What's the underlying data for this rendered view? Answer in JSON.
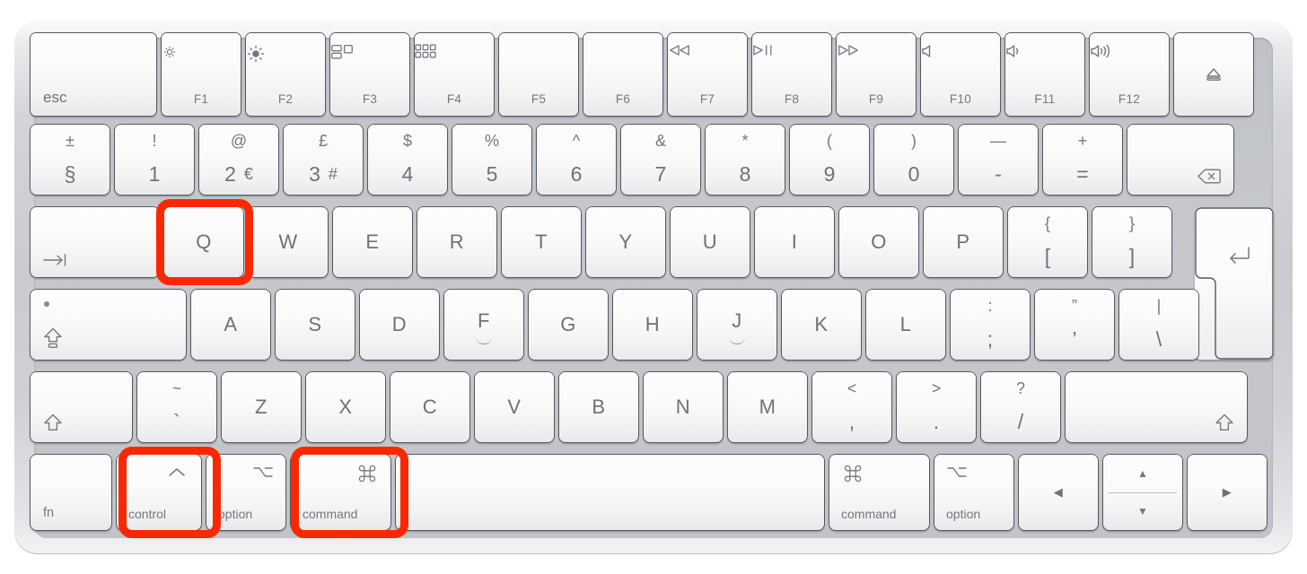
{
  "device": {
    "name": "Apple Magic Keyboard",
    "layout": "UK / ISO",
    "body_color": "#c9cbd0",
    "key_color": "#fafafa",
    "legend_color": "#6e7178"
  },
  "annotations": {
    "highlight_color": "#fa2800",
    "highlighted_keys": [
      "Q",
      "control",
      "command"
    ],
    "shortcut": "control + command + Q"
  },
  "rows": {
    "function_row": [
      {
        "id": "esc",
        "label": "esc",
        "icon": "",
        "icon_name": ""
      },
      {
        "id": "f1",
        "label": "F1",
        "icon": "brightness-down",
        "icon_name": "brightness-down-icon"
      },
      {
        "id": "f2",
        "label": "F2",
        "icon": "brightness-up",
        "icon_name": "brightness-up-icon"
      },
      {
        "id": "f3",
        "label": "F3",
        "icon": "mission-control",
        "icon_name": "mission-control-icon"
      },
      {
        "id": "f4",
        "label": "F4",
        "icon": "launchpad",
        "icon_name": "launchpad-icon"
      },
      {
        "id": "f5",
        "label": "F5",
        "icon": "",
        "icon_name": ""
      },
      {
        "id": "f6",
        "label": "F6",
        "icon": "",
        "icon_name": ""
      },
      {
        "id": "f7",
        "label": "F7",
        "icon": "rewind",
        "icon_name": "rewind-icon"
      },
      {
        "id": "f8",
        "label": "F8",
        "icon": "play-pause",
        "icon_name": "play-pause-icon"
      },
      {
        "id": "f9",
        "label": "F9",
        "icon": "fast-forward",
        "icon_name": "fast-forward-icon"
      },
      {
        "id": "f10",
        "label": "F10",
        "icon": "mute",
        "icon_name": "mute-icon"
      },
      {
        "id": "f11",
        "label": "F11",
        "icon": "volume-down",
        "icon_name": "volume-down-icon"
      },
      {
        "id": "f12",
        "label": "F12",
        "icon": "volume-up",
        "icon_name": "volume-up-icon"
      },
      {
        "id": "eject",
        "label": "",
        "icon": "eject",
        "icon_name": "eject-icon"
      }
    ],
    "number_row": [
      {
        "id": "section",
        "top": "±",
        "bottom": "§",
        "alt": ""
      },
      {
        "id": "digit1",
        "top": "!",
        "bottom": "1",
        "alt": ""
      },
      {
        "id": "digit2",
        "top": "@",
        "bottom": "2",
        "alt": "€"
      },
      {
        "id": "digit3",
        "top": "£",
        "bottom": "3",
        "alt": "#"
      },
      {
        "id": "digit4",
        "top": "$",
        "bottom": "4",
        "alt": ""
      },
      {
        "id": "digit5",
        "top": "%",
        "bottom": "5",
        "alt": ""
      },
      {
        "id": "digit6",
        "top": "^",
        "bottom": "6",
        "alt": ""
      },
      {
        "id": "digit7",
        "top": "&",
        "bottom": "7",
        "alt": ""
      },
      {
        "id": "digit8",
        "top": "*",
        "bottom": "8",
        "alt": ""
      },
      {
        "id": "digit9",
        "top": "(",
        "bottom": "9",
        "alt": ""
      },
      {
        "id": "digit0",
        "top": ")",
        "bottom": "0",
        "alt": ""
      },
      {
        "id": "minus",
        "top": "—",
        "bottom": "-",
        "alt": ""
      },
      {
        "id": "equal",
        "top": "+",
        "bottom": "=",
        "alt": ""
      },
      {
        "id": "delete",
        "top": "",
        "bottom": "",
        "alt": "",
        "icon_name": "delete-icon"
      }
    ],
    "top_letter_row": [
      {
        "id": "tab",
        "label": "",
        "icon_name": "tab-icon"
      },
      {
        "id": "q",
        "label": "Q"
      },
      {
        "id": "w",
        "label": "W"
      },
      {
        "id": "e",
        "label": "E"
      },
      {
        "id": "r",
        "label": "R"
      },
      {
        "id": "t",
        "label": "T"
      },
      {
        "id": "y",
        "label": "Y"
      },
      {
        "id": "u",
        "label": "U"
      },
      {
        "id": "i",
        "label": "I"
      },
      {
        "id": "o",
        "label": "O"
      },
      {
        "id": "p",
        "label": "P"
      },
      {
        "id": "bracketleft",
        "top": "{",
        "bottom": "["
      },
      {
        "id": "bracketright",
        "top": "}",
        "bottom": "]"
      }
    ],
    "home_row": [
      {
        "id": "capslock",
        "label": "",
        "icon_name": "caps-lock-icon"
      },
      {
        "id": "a",
        "label": "A"
      },
      {
        "id": "s",
        "label": "S"
      },
      {
        "id": "d",
        "label": "D"
      },
      {
        "id": "f",
        "label": "F",
        "homing": true
      },
      {
        "id": "g",
        "label": "G"
      },
      {
        "id": "h",
        "label": "H"
      },
      {
        "id": "j",
        "label": "J",
        "homing": true
      },
      {
        "id": "k",
        "label": "K"
      },
      {
        "id": "l",
        "label": "L"
      },
      {
        "id": "semicolon",
        "top": ":",
        "bottom": ";"
      },
      {
        "id": "quote",
        "top": "”",
        "bottom": "’"
      },
      {
        "id": "backslash",
        "top": "|",
        "bottom": "\\"
      }
    ],
    "bottom_letter_row": [
      {
        "id": "shift-left",
        "label": "",
        "icon_name": "shift-icon"
      },
      {
        "id": "grave",
        "top": "~",
        "bottom": "`"
      },
      {
        "id": "z",
        "label": "Z"
      },
      {
        "id": "x",
        "label": "X"
      },
      {
        "id": "c",
        "label": "C"
      },
      {
        "id": "v",
        "label": "V"
      },
      {
        "id": "b",
        "label": "B"
      },
      {
        "id": "n",
        "label": "N"
      },
      {
        "id": "m",
        "label": "M"
      },
      {
        "id": "comma",
        "top": "<",
        "bottom": ","
      },
      {
        "id": "period",
        "top": ">",
        "bottom": "."
      },
      {
        "id": "slash",
        "top": "?",
        "bottom": "/"
      },
      {
        "id": "shift-right",
        "label": "",
        "icon_name": "shift-icon"
      }
    ],
    "modifier_row": [
      {
        "id": "fn",
        "label": "fn",
        "glyph": "",
        "glyph_name": ""
      },
      {
        "id": "control",
        "label": "control",
        "glyph": "ˆ",
        "glyph_name": "control-caret-icon"
      },
      {
        "id": "option-left",
        "label": "option",
        "glyph": "⌥",
        "glyph_name": "option-icon"
      },
      {
        "id": "command-left",
        "label": "command",
        "glyph": "⌘",
        "glyph_name": "command-icon"
      },
      {
        "id": "space",
        "label": "",
        "glyph": "",
        "glyph_name": ""
      },
      {
        "id": "command-right",
        "label": "command",
        "glyph": "⌘",
        "glyph_name": "command-icon"
      },
      {
        "id": "option-right",
        "label": "option",
        "glyph": "⌥",
        "glyph_name": "option-icon"
      },
      {
        "id": "arrow-left",
        "label": "",
        "glyph": "◀",
        "glyph_name": "arrow-left-icon"
      },
      {
        "id": "arrow-up",
        "label": "",
        "glyph": "▲",
        "glyph_name": "arrow-up-icon"
      },
      {
        "id": "arrow-down",
        "label": "",
        "glyph": "▼",
        "glyph_name": "arrow-down-icon"
      },
      {
        "id": "arrow-right",
        "label": "",
        "glyph": "▶",
        "glyph_name": "arrow-right-icon"
      }
    ]
  }
}
